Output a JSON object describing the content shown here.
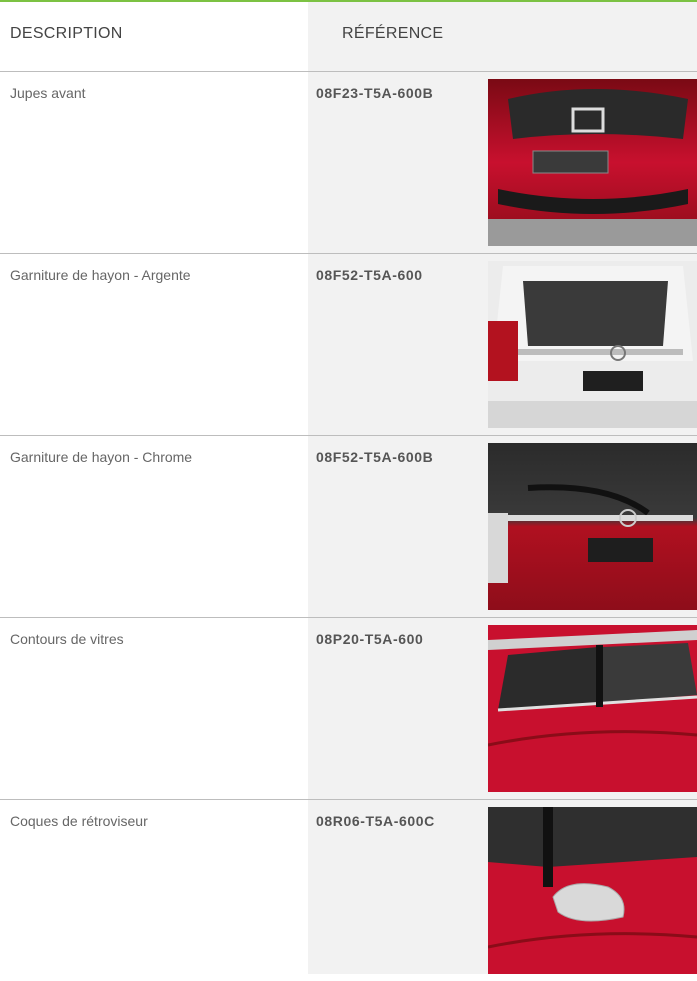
{
  "headers": {
    "description": "DESCRIPTION",
    "reference": "RÉFÉRENCE"
  },
  "colors": {
    "accent_rule": "#7cc243",
    "column_bg": "#f2f2f2",
    "car_red": "#c8102e"
  },
  "rows": [
    {
      "description": "Jupes avant",
      "reference": "08F23-T5A-600B",
      "image": "red-car-front-lower-skirt"
    },
    {
      "description": "Garniture de hayon - Argente",
      "reference": "08F52-T5A-600",
      "image": "white-car-tailgate-silver-trim"
    },
    {
      "description": "Garniture de hayon - Chrome",
      "reference": "08F52-T5A-600B",
      "image": "red-car-tailgate-chrome-trim"
    },
    {
      "description": "Contours de vitres",
      "reference": "08P20-T5A-600",
      "image": "red-car-side-window-trims"
    },
    {
      "description": "Coques de rétroviseur",
      "reference": "08R06-T5A-600C",
      "image": "red-car-mirror-cover"
    }
  ]
}
